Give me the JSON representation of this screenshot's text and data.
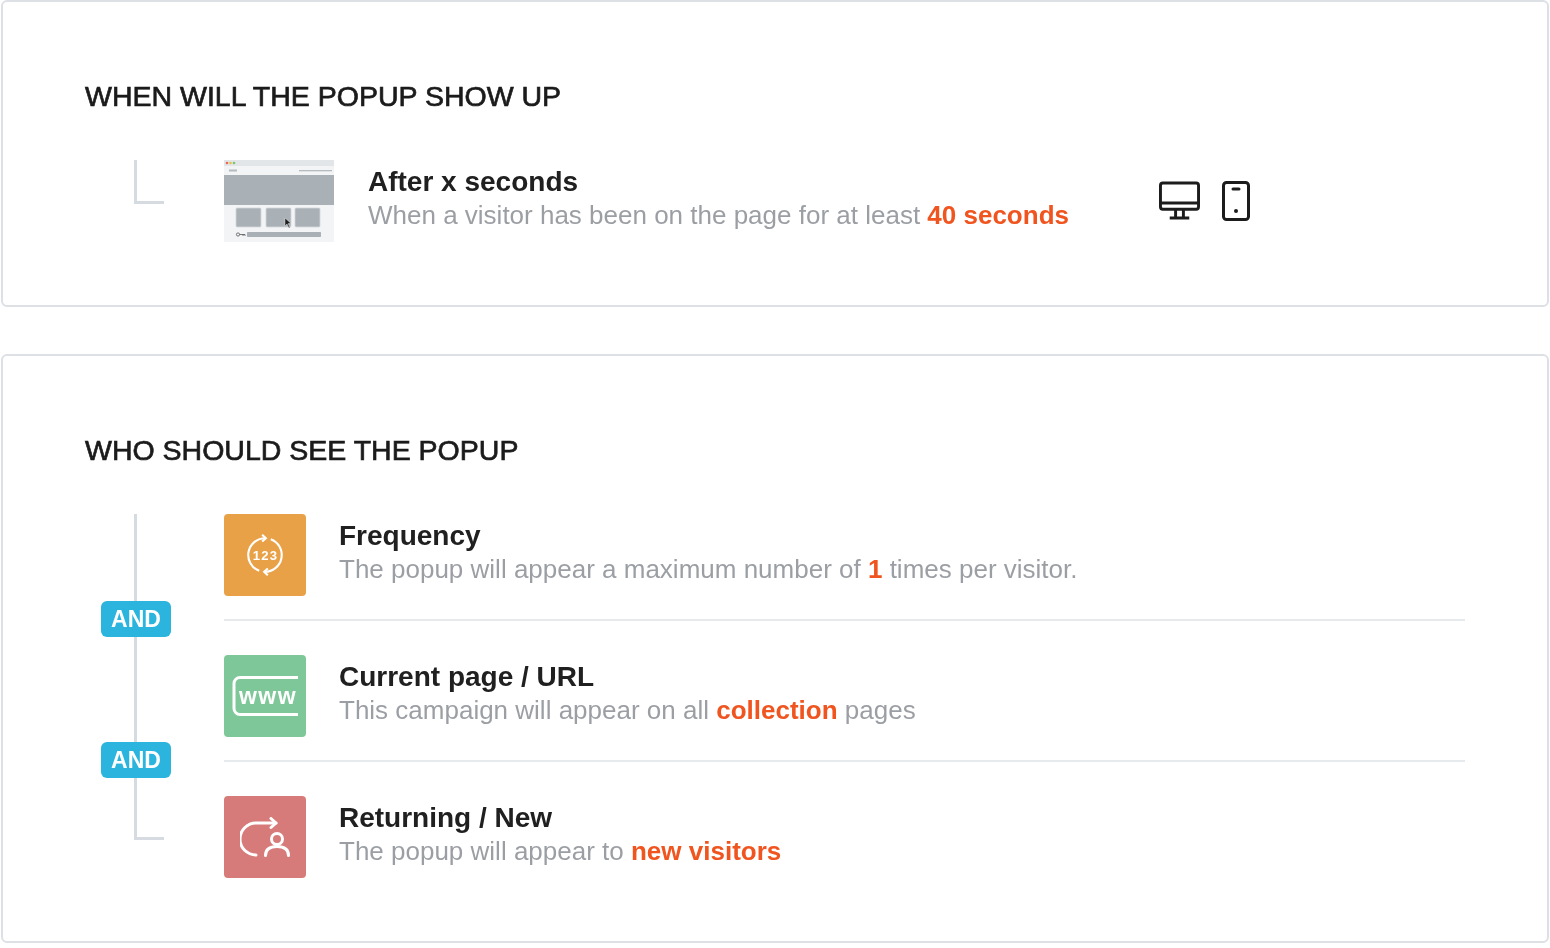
{
  "sections": [
    {
      "heading": "WHEN WILL THE POPUP SHOW UP",
      "conditions": [
        {
          "kind": "timer",
          "title": "After x seconds",
          "description": "When a visitor has been on the page for at least **40 seconds**"
        }
      ]
    },
    {
      "heading": "WHO SHOULD SEE THE POPUP",
      "conditions": [
        {
          "kind": "frequency",
          "color": "#e9a147",
          "icon_text": "123",
          "title": "Frequency",
          "description": "The popup will appear a maximum number of **1** times per visitor."
        },
        {
          "kind": "page_url",
          "color": "#7ec799",
          "icon_text": "www",
          "connector": "AND",
          "title": "Current page / URL",
          "description": "This campaign will appear on all **collection** pages"
        },
        {
          "kind": "visitor_type",
          "color": "#d77a7a",
          "connector": "AND",
          "title": "Returning / New",
          "description": "The popup will appear to **new visitors**"
        }
      ]
    }
  ]
}
